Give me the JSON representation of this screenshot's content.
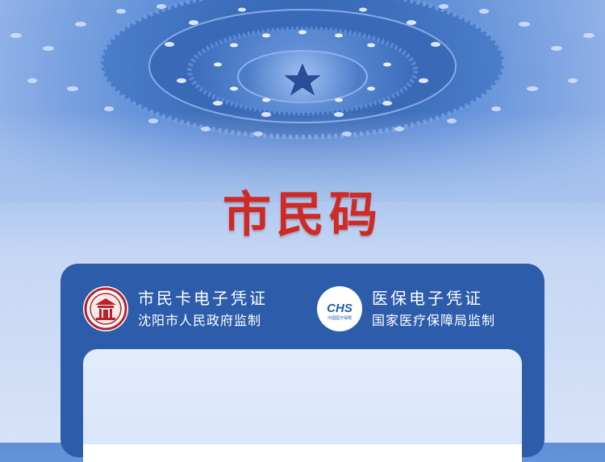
{
  "header": {
    "title": "市民码"
  },
  "credentials": {
    "citizen_card": {
      "title": "市民卡电子凭证",
      "subtitle": "沈阳市人民政府监制",
      "icon": "shenyang-emblem-icon"
    },
    "medical_insurance": {
      "title": "医保电子凭证",
      "subtitle": "国家医疗保障局监制",
      "icon": "chs-logo-icon",
      "logo_text": "CHS",
      "logo_caption": "中国医疗保障"
    }
  },
  "colors": {
    "title_red": "#cf2a25",
    "card_blue": "#2d5cab",
    "panel": "#dde7fb"
  }
}
